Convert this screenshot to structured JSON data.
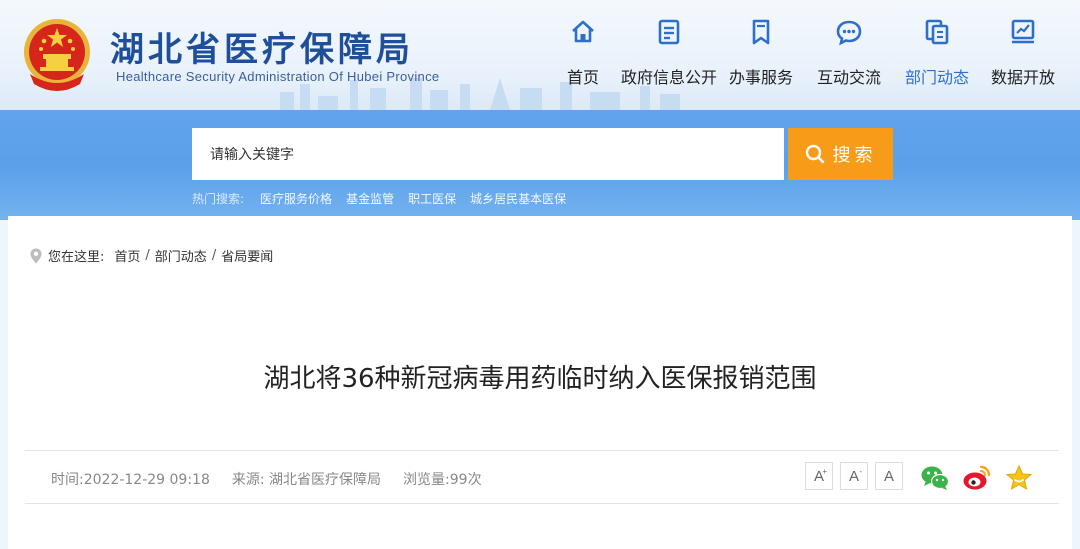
{
  "header": {
    "title": "湖北省医疗保障局",
    "subtitle": "Healthcare Security Administration Of Hubei Province"
  },
  "nav": [
    {
      "label": "首页",
      "icon": "home-icon"
    },
    {
      "label": "政府信息公开",
      "icon": "document-icon"
    },
    {
      "label": "办事服务",
      "icon": "bookmark-icon"
    },
    {
      "label": "互动交流",
      "icon": "chat-icon"
    },
    {
      "label": "部门动态",
      "icon": "files-icon",
      "active": true
    },
    {
      "label": "数据开放",
      "icon": "chart-icon"
    }
  ],
  "search": {
    "placeholder": "请输入关键字",
    "button_label": "搜索",
    "hot_label": "热门搜索:",
    "hot_terms": [
      "医疗服务价格",
      "基金监管",
      "职工医保",
      "城乡居民基本医保"
    ]
  },
  "breadcrumb": {
    "prefix": "您在这里:",
    "items": [
      "首页",
      "部门动态",
      "省局要闻"
    ],
    "separator": "/"
  },
  "article": {
    "title": "湖北将36种新冠病毒用药临时纳入医保报销范围",
    "time": "时间:2022-12-29 09:18",
    "source": "来源: 湖北省医疗保障局",
    "views": "浏览量:99次"
  },
  "font_controls": {
    "increase": "A",
    "decrease": "A",
    "reset": "A",
    "increase_mark": "+",
    "decrease_mark": "-"
  },
  "colors": {
    "accent": "#2f6fcc",
    "search_button": "#f79b18",
    "band": "#5aa0ea"
  }
}
